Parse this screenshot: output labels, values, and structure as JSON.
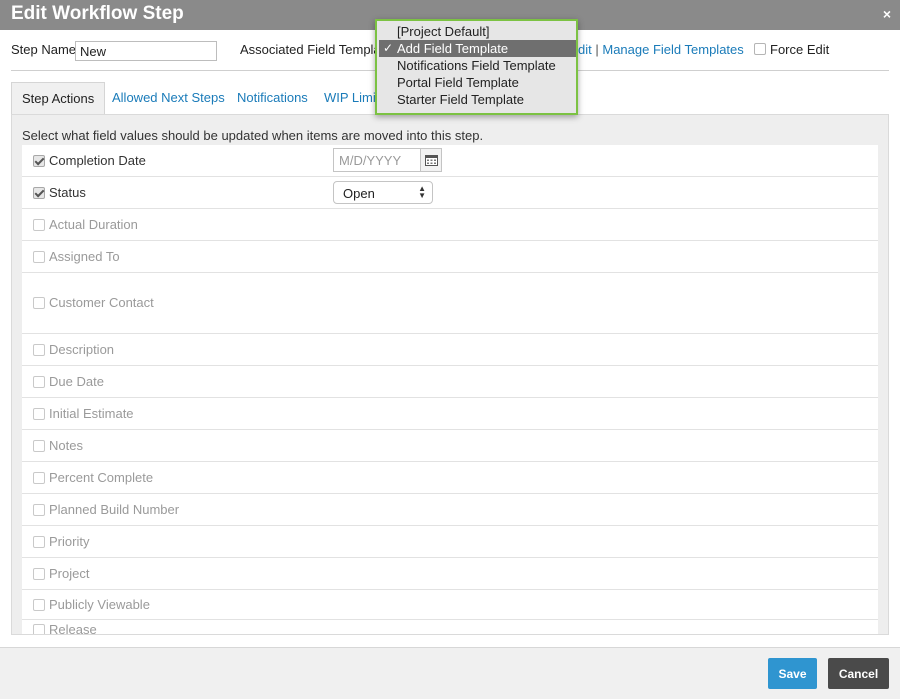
{
  "dialog": {
    "title": "Edit Workflow Step",
    "close_symbol": "×"
  },
  "top": {
    "step_name_label": "Step Name",
    "step_name_value": "New",
    "associated_label": "Associated Field Templat",
    "edit_link_visible": "dit",
    "separator": "|",
    "manage_link": "Manage Field Templates",
    "force_edit_label": "Force Edit",
    "force_edit_checked": false
  },
  "template_dropdown": {
    "options": [
      "[Project Default]",
      "Add Field Template",
      "Notifications Field Template",
      "Portal Field Template",
      "Starter Field Template"
    ],
    "selected": "Add Field Template",
    "check_symbol": "✓",
    "border_color": "#7cc243"
  },
  "tabs": [
    {
      "label": "Step Actions",
      "active": true
    },
    {
      "label": "Allowed Next Steps",
      "active": false
    },
    {
      "label": "Notifications",
      "active": false
    },
    {
      "label": "WIP Limit",
      "active": false
    }
  ],
  "panel": {
    "description": "Select what field values should be updated when items are moved into this step.",
    "fields": [
      {
        "label": "Completion Date",
        "checked": true,
        "enabled": true
      },
      {
        "label": "Status",
        "checked": true,
        "enabled": true
      },
      {
        "label": "Actual Duration",
        "checked": false,
        "enabled": false
      },
      {
        "label": "Assigned To",
        "checked": false,
        "enabled": false
      },
      {
        "label": "Customer Contact",
        "checked": false,
        "enabled": false
      },
      {
        "label": "Description",
        "checked": false,
        "enabled": false
      },
      {
        "label": "Due Date",
        "checked": false,
        "enabled": false
      },
      {
        "label": "Initial Estimate",
        "checked": false,
        "enabled": false
      },
      {
        "label": "Notes",
        "checked": false,
        "enabled": false
      },
      {
        "label": "Percent Complete",
        "checked": false,
        "enabled": false
      },
      {
        "label": "Planned Build Number",
        "checked": false,
        "enabled": false
      },
      {
        "label": "Priority",
        "checked": false,
        "enabled": false
      },
      {
        "label": "Project",
        "checked": false,
        "enabled": false
      },
      {
        "label": "Publicly Viewable",
        "checked": false,
        "enabled": false
      },
      {
        "label": "Release",
        "checked": false,
        "enabled": false
      }
    ],
    "completion_date_placeholder": "M/D/YYYY",
    "status_value": "Open"
  },
  "footer": {
    "save_label": "Save",
    "cancel_label": "Cancel"
  },
  "colors": {
    "titlebar": "#8a8a8a",
    "link": "#1a7bb9",
    "save": "#2f95d0",
    "cancel": "#4a4a4a"
  }
}
